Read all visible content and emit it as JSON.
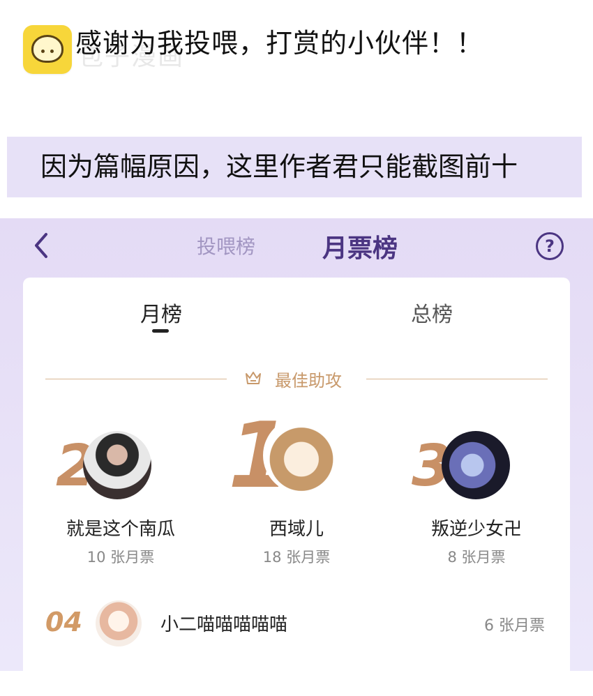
{
  "note": {
    "thanks_text": "感谢为我投喂，打赏的小伙伴！！",
    "watermark": "包子漫画",
    "banner_text": "因为篇幅原因，这里作者君只能截图前十"
  },
  "header": {
    "back_icon": "chevron-left-icon",
    "tab_feed": "投喂榜",
    "tab_monthly": "月票榜",
    "help_label": "?"
  },
  "subtabs": {
    "monthly": "月榜",
    "total": "总榜"
  },
  "section": {
    "best_label": "最佳助攻",
    "crown_icon": "crown-icon"
  },
  "podium": [
    {
      "rank": "2",
      "name": "就是这个南瓜",
      "votes": "10 张月票"
    },
    {
      "rank": "1",
      "name": "西域儿",
      "votes": "18 张月票"
    },
    {
      "rank": "3",
      "name": "叛逆少女卍",
      "votes": "8 张月票"
    }
  ],
  "list": [
    {
      "rank": "04",
      "name": "小二喵喵喵喵喵",
      "votes": "6 张月票"
    }
  ],
  "colors": {
    "accent": "#4b3582",
    "gold": "#c89066",
    "banner": "#e7e1f7"
  }
}
